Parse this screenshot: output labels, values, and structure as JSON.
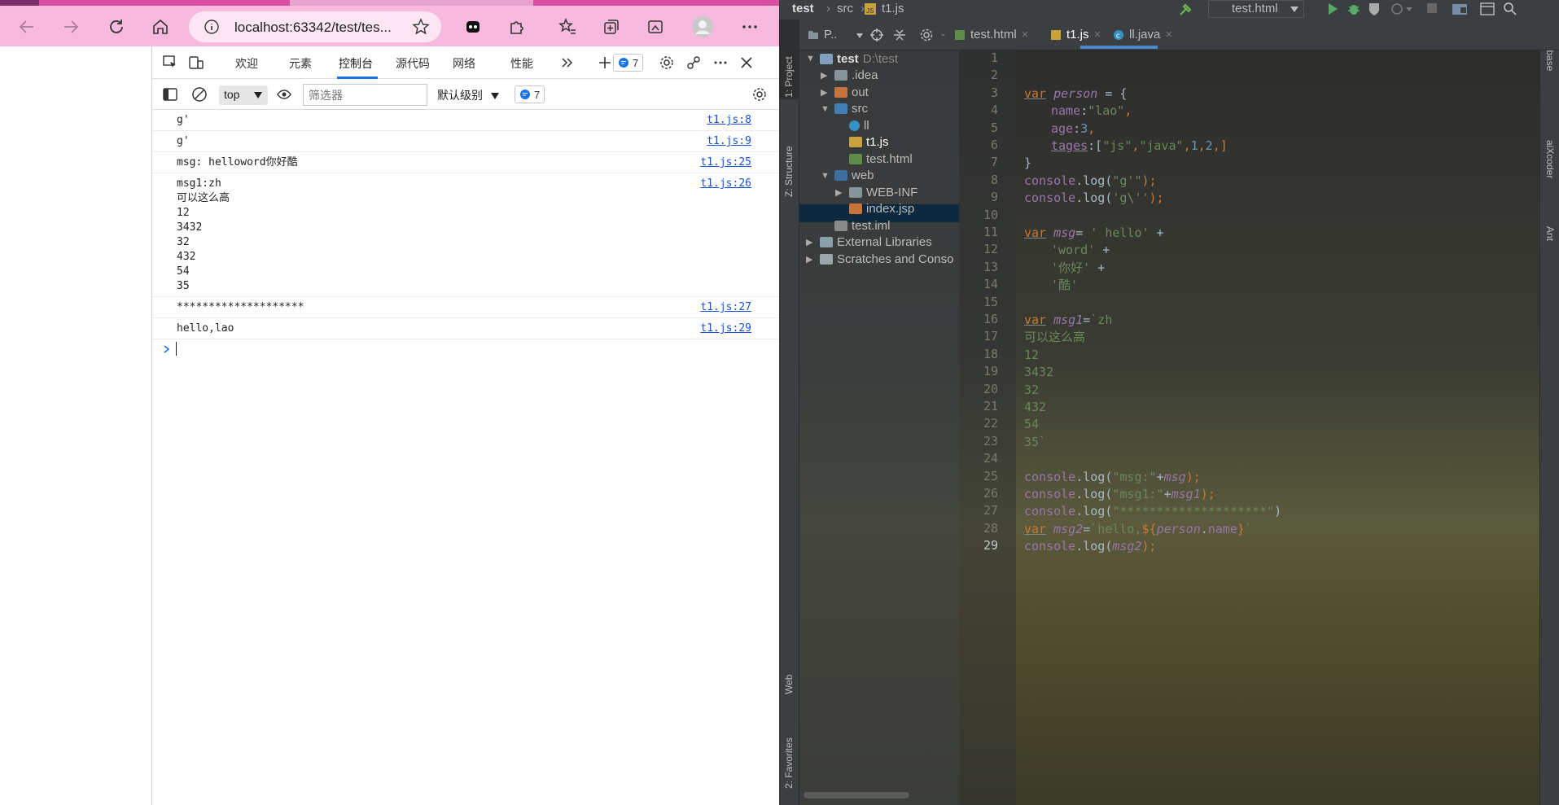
{
  "browser": {
    "address": "localhost:63342/test/tes...",
    "colors": {
      "toolbar": "#f7b9dd",
      "accent": "#1a73e8"
    }
  },
  "devtools": {
    "tabs": [
      "欢迎",
      "元素",
      "控制台",
      "源代码",
      "网络",
      "性能"
    ],
    "active_tab": "控制台",
    "issue_count": "7",
    "context": "top",
    "filter_placeholder": "筛选器",
    "level": "默认级别",
    "message_count": "7"
  },
  "console": {
    "rows": [
      {
        "text": "g'",
        "source": "t1.js:8"
      },
      {
        "text": "g'",
        "source": "t1.js:9"
      },
      {
        "text": "msg: helloword你好酷",
        "source": "t1.js:25"
      },
      {
        "text": "msg1:zh\n可以这么高\n12\n3432\n32\n432\n54\n35",
        "source": "t1.js:26"
      },
      {
        "text": "********************",
        "source": "t1.js:27"
      },
      {
        "text": "hello,lao",
        "source": "t1.js:29"
      }
    ]
  },
  "ide": {
    "breadcrumb": [
      "test",
      "src",
      "t1.js"
    ],
    "run_config": "test.html",
    "editor_tabs": [
      {
        "label": "test.html",
        "active": false
      },
      {
        "label": "t1.js",
        "active": true
      },
      {
        "label": "ll.java",
        "active": false
      }
    ],
    "project_panel_label": "P..",
    "left_strip": [
      "1: Project",
      "Z: Structure",
      "Web",
      "2: Favorites"
    ],
    "right_strip": [
      "Database",
      "aiXcoder",
      "Ant"
    ],
    "tree": [
      {
        "label": "test",
        "extra": "D:\\test",
        "depth": 0,
        "kind": "module",
        "open": true
      },
      {
        "label": ".idea",
        "depth": 1,
        "kind": "folder",
        "open": false
      },
      {
        "label": "out",
        "depth": 1,
        "kind": "folder-orange",
        "open": false
      },
      {
        "label": "src",
        "depth": 1,
        "kind": "folder-blue",
        "open": true
      },
      {
        "label": "ll",
        "depth": 2,
        "kind": "java"
      },
      {
        "label": "t1.js",
        "depth": 2,
        "kind": "js",
        "selected": true
      },
      {
        "label": "test.html",
        "depth": 2,
        "kind": "html"
      },
      {
        "label": "web",
        "depth": 1,
        "kind": "folder-web",
        "open": true
      },
      {
        "label": "WEB-INF",
        "depth": 2,
        "kind": "folder",
        "open": false
      },
      {
        "label": "index.jsp",
        "depth": 2,
        "kind": "jsp"
      },
      {
        "label": "test.iml",
        "depth": 1,
        "kind": "iml"
      },
      {
        "label": "External Libraries",
        "depth": 0,
        "kind": "lib",
        "open": false
      },
      {
        "label": "Scratches and Conso",
        "depth": 0,
        "kind": "scratch",
        "open": false
      }
    ],
    "line_numbers": [
      "1",
      "2",
      "3",
      "4",
      "5",
      "6",
      "7",
      "8",
      "9",
      "10",
      "11",
      "12",
      "13",
      "14",
      "15",
      "16",
      "17",
      "18",
      "19",
      "20",
      "21",
      "22",
      "23",
      "24",
      "25",
      "26",
      "27",
      "28",
      "29"
    ],
    "code": {
      "l3": [
        "var",
        "person",
        " = {"
      ],
      "l4": [
        "name",
        ":",
        "\"lao\"",
        ","
      ],
      "l5": [
        "age",
        ":",
        "3",
        ","
      ],
      "l6": [
        "tages",
        ":[",
        "\"js\"",
        ",",
        "\"java\"",
        ",",
        "1",
        ",",
        "2",
        ",]"
      ],
      "l7": "}",
      "l8": [
        "console",
        ".",
        "log",
        "(",
        "\"g'\"",
        ");"
      ],
      "l9": [
        "console",
        ".",
        "log",
        "(",
        "'g\\''",
        ");"
      ],
      "l11": [
        "var",
        "msg",
        "= ",
        "' hello'",
        " +"
      ],
      "l12": [
        "'word'",
        " +"
      ],
      "l13": [
        "'你好'",
        " +"
      ],
      "l14": "'酷'",
      "l16": [
        "var",
        "msg1",
        "=",
        "`zh"
      ],
      "l17": "可以这么高",
      "l18": "12",
      "l19": "3432",
      "l20": "32",
      "l21": "432",
      "l22": "54",
      "l23": "35`",
      "l25": [
        "console",
        ".",
        "log",
        "(",
        "\"msg:\"",
        "+",
        "msg",
        ");"
      ],
      "l26": [
        "console",
        ".",
        "log",
        "(",
        "\"msg1:\"",
        "+",
        "msg1",
        ");"
      ],
      "l27": [
        "console",
        ".",
        "log",
        "(",
        "\"********************\"",
        ")"
      ],
      "l28": [
        "var",
        "msg2",
        "=",
        "`hello,",
        "${",
        "person",
        ".",
        "name",
        "}",
        "`"
      ],
      "l29": [
        "console",
        ".",
        "log",
        "(",
        "msg2",
        ");"
      ]
    }
  }
}
